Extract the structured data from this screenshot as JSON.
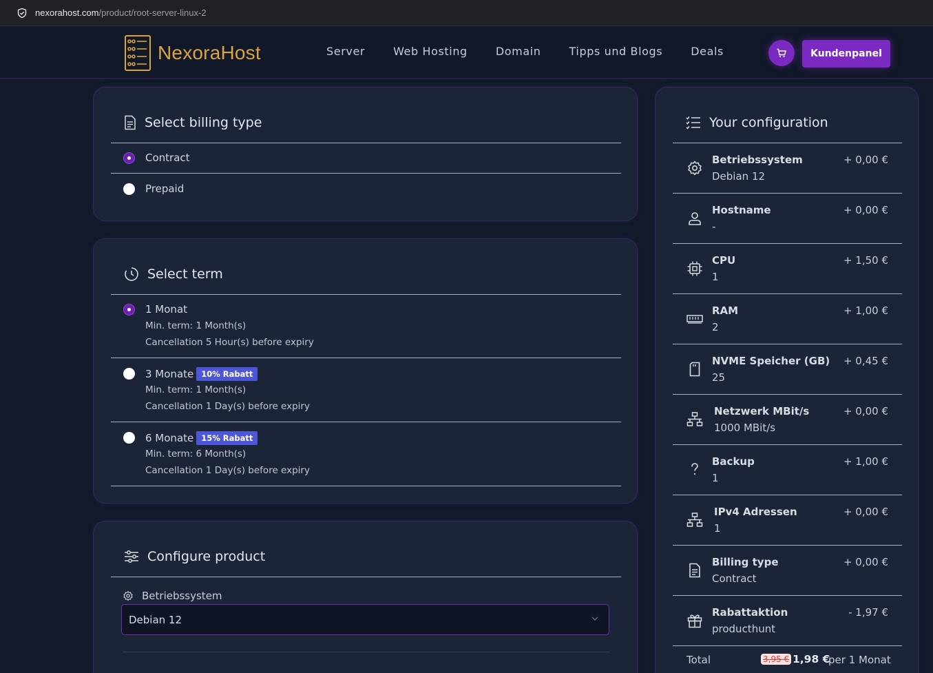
{
  "browser": {
    "url_host": "nexorahost.com",
    "url_path": "/product/root-server-linux-2"
  },
  "nav": {
    "brand": "NexoraHost",
    "menu": [
      "Server",
      "Web Hosting",
      "Domain",
      "Tipps und Blogs",
      "Deals"
    ],
    "cta": "Kundenpanel"
  },
  "colors": {
    "accent": "#7a2ac0",
    "brand": "#d9a441",
    "badge": "#4c56d6",
    "card_bg": "#1b2537",
    "page_bg": "#121a2b"
  },
  "billing": {
    "title": "Select billing type",
    "options": [
      {
        "label": "Contract",
        "selected": true
      },
      {
        "label": "Prepaid",
        "selected": false
      }
    ]
  },
  "term": {
    "title": "Select term",
    "options": [
      {
        "label": "1 Monat",
        "badge": "",
        "min": "Min. term: 1 Month(s)",
        "cancel": "Cancellation 5 Hour(s) before expiry",
        "selected": true
      },
      {
        "label": "3 Monate",
        "badge": "10% Rabatt",
        "min": "Min. term: 1 Month(s)",
        "cancel": "Cancellation 1 Day(s) before expiry",
        "selected": false
      },
      {
        "label": "6 Monate",
        "badge": "15% Rabatt",
        "min": "Min. term: 6 Month(s)",
        "cancel": "Cancellation 1 Day(s) before expiry",
        "selected": false
      }
    ]
  },
  "configure": {
    "title": "Configure product",
    "os_label": "Betriebssystem",
    "os_value": "Debian 12"
  },
  "summary": {
    "title": "Your configuration",
    "rows": [
      {
        "icon": "gear-icon",
        "name": "Betriebssystem",
        "value": "Debian 12",
        "price": "+ 0,00 €"
      },
      {
        "icon": "user-icon",
        "name": "Hostname",
        "value": "-",
        "price": "+ 0,00 €"
      },
      {
        "icon": "cpu-icon",
        "name": "CPU",
        "value": "1",
        "price": "+ 1,50 €"
      },
      {
        "icon": "ram-icon",
        "name": "RAM",
        "value": "2",
        "price": "+ 1,00 €"
      },
      {
        "icon": "sd-card-icon",
        "name": "NVME Speicher (GB)",
        "value": "25",
        "price": "+ 0,45 €"
      },
      {
        "icon": "network-icon",
        "name": "Netzwerk MBit/s",
        "value": "1000 MBit/s",
        "price": "+ 0,00 €"
      },
      {
        "icon": "question-icon",
        "name": "Backup",
        "value": "1",
        "price": "+ 1,00 €"
      },
      {
        "icon": "network-icon",
        "name": "IPv4 Adressen",
        "value": "1",
        "price": "+ 0,00 €"
      },
      {
        "icon": "document-icon",
        "name": "Billing type",
        "value": "Contract",
        "price": "+ 0,00 €"
      },
      {
        "icon": "gift-icon",
        "name": "Rabattaktion",
        "value": "producthunt",
        "price": "- 1,97 €"
      }
    ],
    "total_label": "Total",
    "old_price": "3,95 €",
    "new_price": "1,98 €",
    "period": "per 1 Monat"
  }
}
